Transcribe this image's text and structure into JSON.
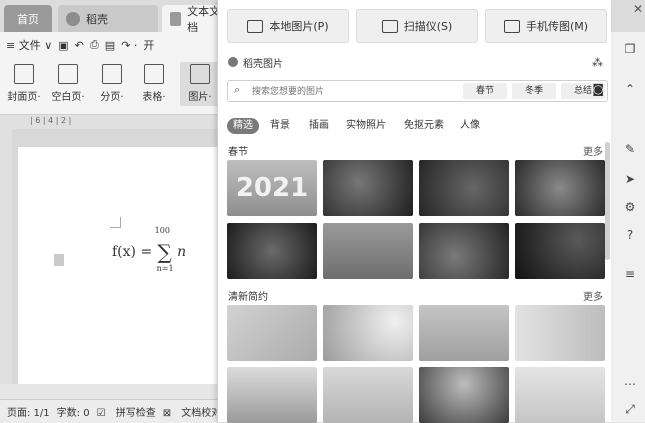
{
  "tabs": [
    {
      "label": "首页"
    },
    {
      "label": "稻壳"
    },
    {
      "label": "文本文档"
    }
  ],
  "menubar": {
    "menu_label": "≡ 文件 ∨",
    "tail": "开"
  },
  "ribbon": [
    {
      "label": "封面页·"
    },
    {
      "label": "空白页·"
    },
    {
      "label": "分页·"
    },
    {
      "label": "表格·"
    },
    {
      "label": "图片·"
    }
  ],
  "ruler": {
    "marks": "| 6 |  4  |  2  |"
  },
  "document": {
    "formula_lhs": "f(x) = ",
    "sum_upper": "100",
    "sum_lower": "n=1",
    "sum_symbol": "∑",
    "sum_var": "n"
  },
  "statusbar": {
    "page": "页面: 1/1",
    "words": "字数: 0",
    "spellcheck": "拼写检查",
    "doc_proof": "文档校对"
  },
  "popup": {
    "local_image": "本地图片(P)",
    "scanner": "扫描仪(S)",
    "phone_image": "手机传图(M)",
    "section_title": "稻壳图片",
    "search_placeholder": "搜索您想要的图片",
    "search_chips": [
      "春节",
      "冬季",
      "总结"
    ],
    "categories": [
      "精选",
      "背景",
      "插画",
      "实物照片",
      "免抠元素",
      "人像"
    ],
    "sections": [
      {
        "title": "春节",
        "more": "更多"
      },
      {
        "title": "清新简约",
        "more": "更多"
      }
    ],
    "thumb_text_2021": "2021"
  },
  "colors": {
    "accent": "#7a7a7a",
    "panel": "#ffffff"
  }
}
